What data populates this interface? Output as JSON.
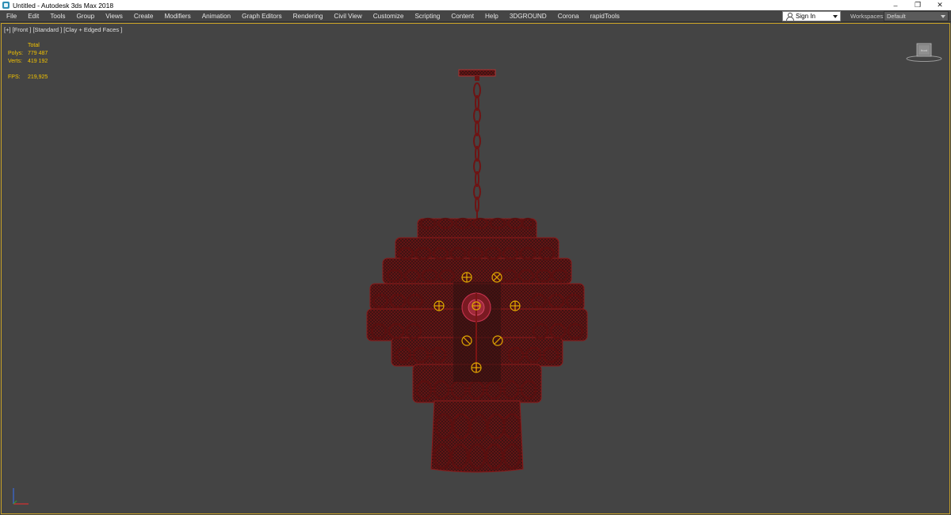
{
  "window": {
    "title": "Untitled - Autodesk 3ds Max 2018",
    "minimize": "–",
    "restore": "❐",
    "close": "✕"
  },
  "menu": {
    "items": [
      "File",
      "Edit",
      "Tools",
      "Group",
      "Views",
      "Create",
      "Modifiers",
      "Animation",
      "Graph Editors",
      "Rendering",
      "Civil View",
      "Customize",
      "Scripting",
      "Content",
      "Help",
      "3DGROUND",
      "Corona",
      "rapidTools"
    ],
    "sign_in": "Sign In",
    "workspaces_label": "Workspaces:",
    "workspaces_value": "Default"
  },
  "viewport": {
    "label": "[+] [Front ] [Standard ] [Clay + Edged Faces ]",
    "stats": {
      "header": "Total",
      "polys_label": "Polys:",
      "polys_value": "779 487",
      "verts_label": "Verts:",
      "verts_value": "419 192",
      "fps_label": "FPS:",
      "fps_value": "219,925"
    },
    "viewcube_label": "front",
    "border_color": "#c9a227",
    "stats_color": "#f2c200",
    "wire_color": "#8a1a1a"
  }
}
